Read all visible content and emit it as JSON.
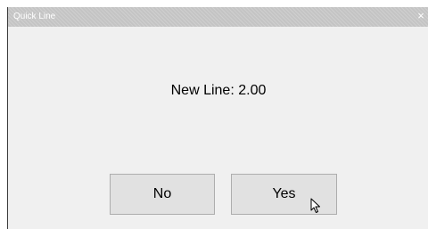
{
  "window": {
    "title": "Quick Line",
    "close_glyph": "×"
  },
  "dialog": {
    "message": "New Line: 2.00"
  },
  "buttons": {
    "no_label": "No",
    "yes_label": "Yes"
  },
  "colors": {
    "titlebar": "#c4c4c4",
    "dialog_bg": "#f0f0f0",
    "button_bg": "#e1e1e1",
    "button_border": "#adadad"
  }
}
